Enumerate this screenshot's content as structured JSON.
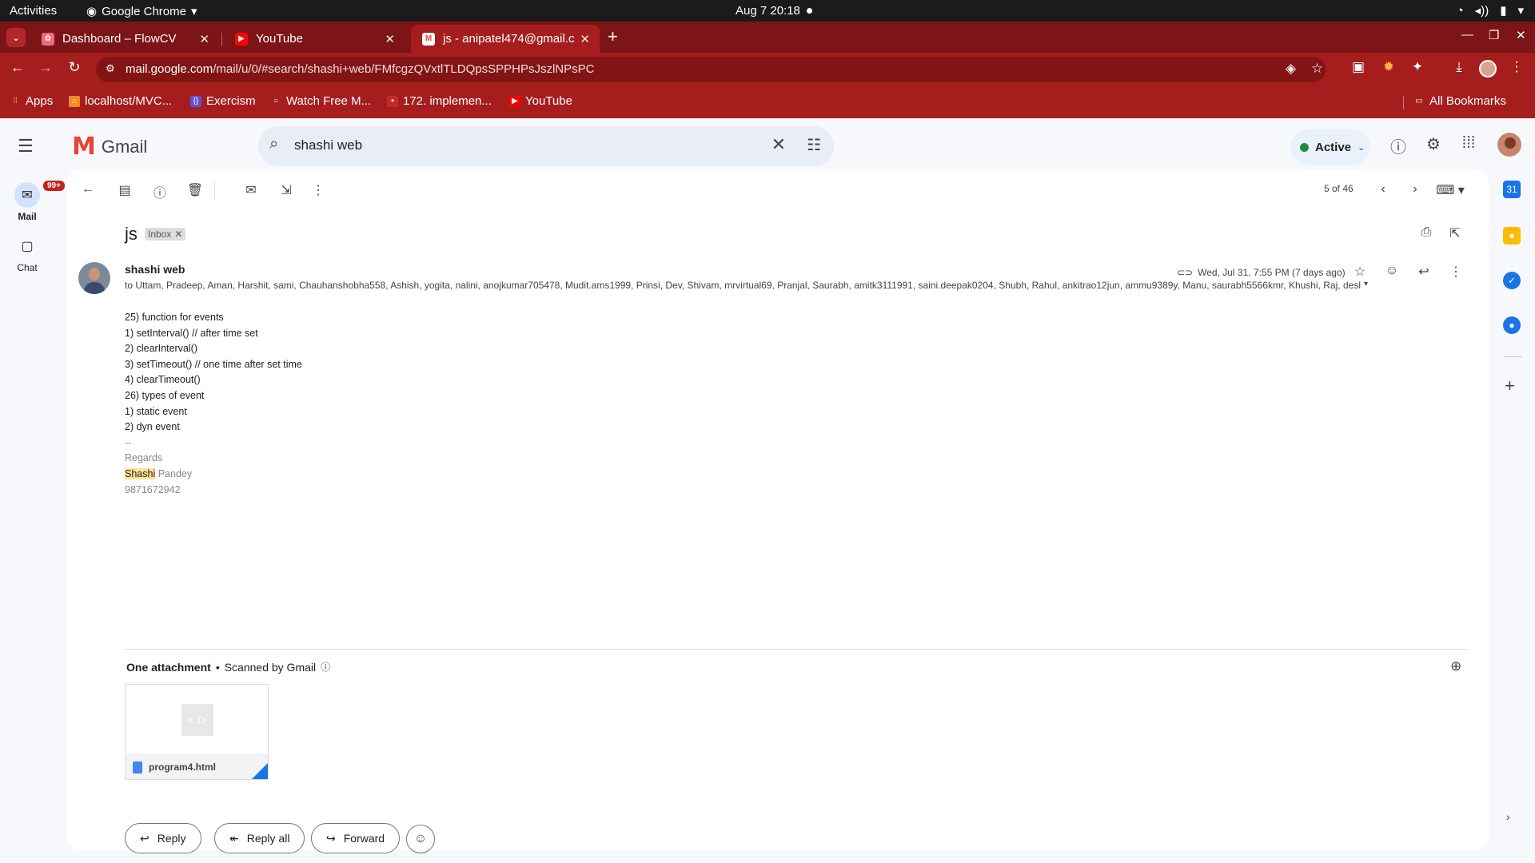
{
  "os_bar": {
    "activities": "Activities",
    "app_name": "Google Chrome",
    "clock": "Aug 7  20:18"
  },
  "browser": {
    "tabs": [
      {
        "title": "Dashboard – FlowCV",
        "active": false
      },
      {
        "title": "YouTube",
        "active": false
      },
      {
        "title": "js - anipatel474@gmail.c",
        "active": true
      }
    ],
    "url_host": "mail.google.com",
    "url_path": "/mail/u/0/#search/shashi+web/FMfcgzQVxtlTLDQpsSPPHPsJszlNPsPC",
    "bookmarks": [
      {
        "label": "Apps",
        "icon": "apps-grid-icon"
      },
      {
        "label": "localhost/MVC...",
        "icon": "localhost-icon"
      },
      {
        "label": "Exercism",
        "icon": "exercism-icon"
      },
      {
        "label": "Watch Free M...",
        "icon": "circle-icon"
      },
      {
        "label": "172. implemen...",
        "icon": "site-icon"
      },
      {
        "label": "YouTube",
        "icon": "youtube-icon"
      }
    ],
    "all_bookmarks": "All Bookmarks",
    "theme_color": "#a51d1d"
  },
  "gmail": {
    "product_name": "Gmail",
    "search_query": "shashi web",
    "status": "Active",
    "rail": [
      {
        "label": "Mail",
        "badge": "99+",
        "icon": "mail-icon"
      },
      {
        "label": "Chat",
        "icon": "chat-icon"
      }
    ],
    "pager": "5 of 46",
    "message": {
      "subject": "js",
      "label": "Inbox",
      "sender": "shashi web",
      "date": "Wed, Jul 31, 7:55 PM (7 days ago)",
      "recipients": "to Uttam, Pradeep, Aman, Harshit, sami, Chauhanshobha558, Ashish, yogita, nalini, anojkumar705478, Mudit.ams1999, Prinsi, Dev, Shivam, mrvirtual69, Pranjal, Saurabh, amitk3111991, saini.deepak0204, Shubh, Rahul, ankitrao12jun, ammu9389y, Manu, saurabh5566kmr, Khushi, Raj, desl",
      "body_lines": [
        "25) function for events",
        "1) setInterval() // after time set",
        "2) clearInterval()",
        "3) setTimeout() // one time after set time",
        "4) clearTimeout()",
        "26) types of event",
        "1) static event",
        "2) dyn event"
      ],
      "signature": {
        "dashes": "--",
        "regards": "Regards",
        "name_highlight": "Shashi",
        "name_rest": " Pandey",
        "phone": "9871672942"
      }
    },
    "attachments": {
      "heading": "One attachment",
      "separator": "•",
      "scanned": "Scanned by Gmail",
      "files": [
        {
          "name": "program4.html",
          "thumb": "< />"
        }
      ]
    },
    "actions": {
      "reply": "Reply",
      "reply_all": "Reply all",
      "forward": "Forward"
    }
  }
}
